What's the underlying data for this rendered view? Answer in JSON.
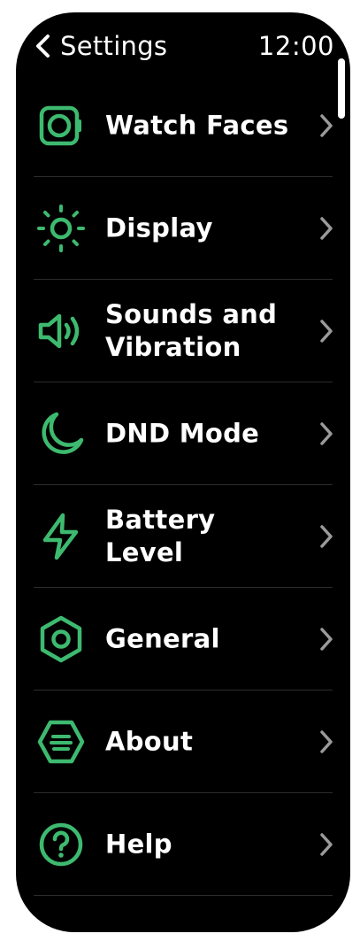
{
  "header": {
    "back_label": "Settings",
    "time": "12:00"
  },
  "colors": {
    "accent": "#3dba6f",
    "background": "#000000",
    "text": "#ffffff",
    "chevron": "#9a9a9a",
    "divider": "#2c2c2c"
  },
  "menu": {
    "items": [
      {
        "label": "Watch Faces",
        "icon": "watch-face-icon"
      },
      {
        "label": "Display",
        "icon": "sun-icon"
      },
      {
        "label": "Sounds and Vibration",
        "icon": "speaker-icon"
      },
      {
        "label": "DND Mode",
        "icon": "moon-icon"
      },
      {
        "label": "Battery Level",
        "icon": "lightning-icon"
      },
      {
        "label": "General",
        "icon": "hexagon-gear-icon"
      },
      {
        "label": "About",
        "icon": "info-lines-icon"
      },
      {
        "label": "Help",
        "icon": "question-icon"
      }
    ]
  }
}
